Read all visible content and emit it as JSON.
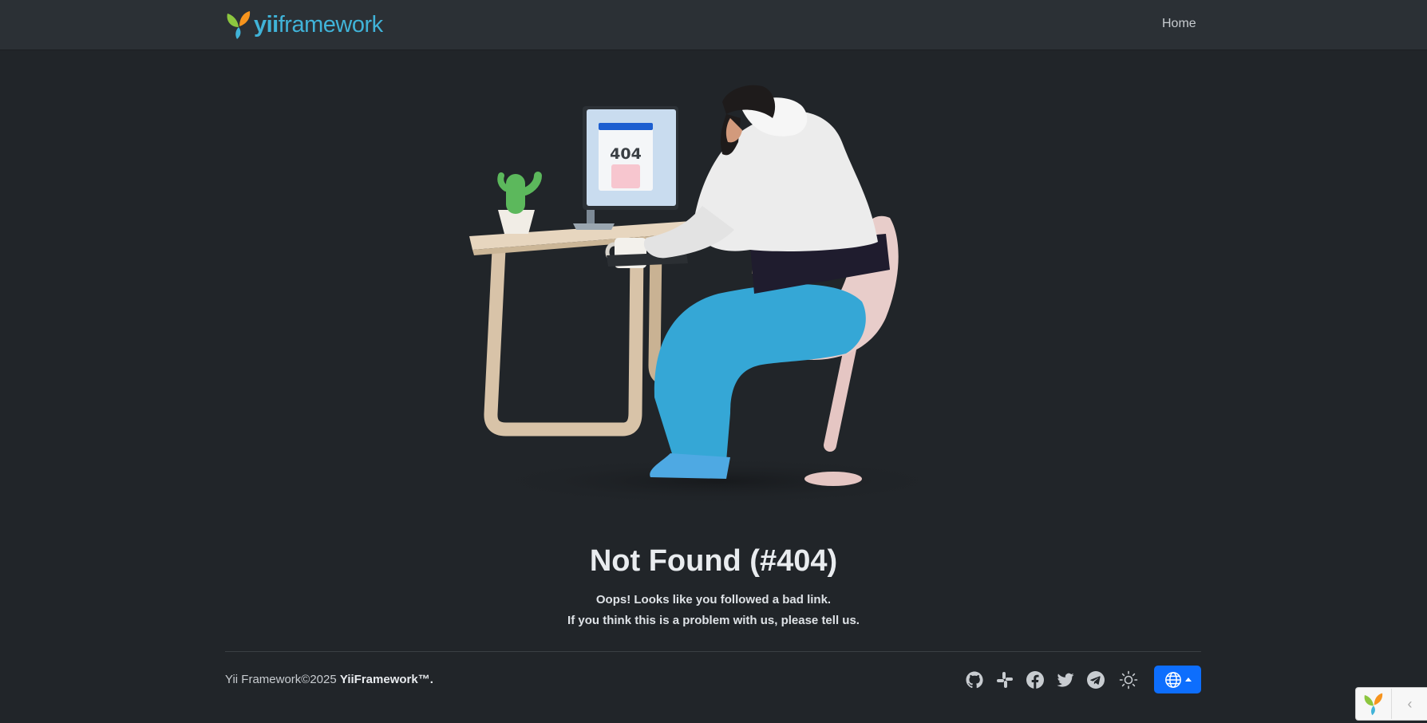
{
  "header": {
    "logo_text_bold": "yii",
    "logo_text_rest": "framework",
    "nav": {
      "home_label": "Home"
    }
  },
  "illustration": {
    "screen_text": "404",
    "icon": "error-404-illustration"
  },
  "error": {
    "title": "Not Found (#404)",
    "line1": "Oops! Looks like you followed a bad link.",
    "line2": "If you think this is a problem with us, please tell us."
  },
  "footer": {
    "copyright": "Yii Framework©2025 ",
    "brand": "YiiFramework™.",
    "social": [
      "github-icon",
      "slack-icon",
      "facebook-icon",
      "twitter-icon",
      "telegram-icon"
    ],
    "theme_icon": "sun-icon",
    "language_icon": "globe-icon"
  },
  "debug_toolbar": {
    "toggle_label": "‹"
  },
  "colors": {
    "background": "#212529",
    "navbar": "#2b3035",
    "accent": "#0d6efd",
    "logo": "#40b3d8"
  }
}
